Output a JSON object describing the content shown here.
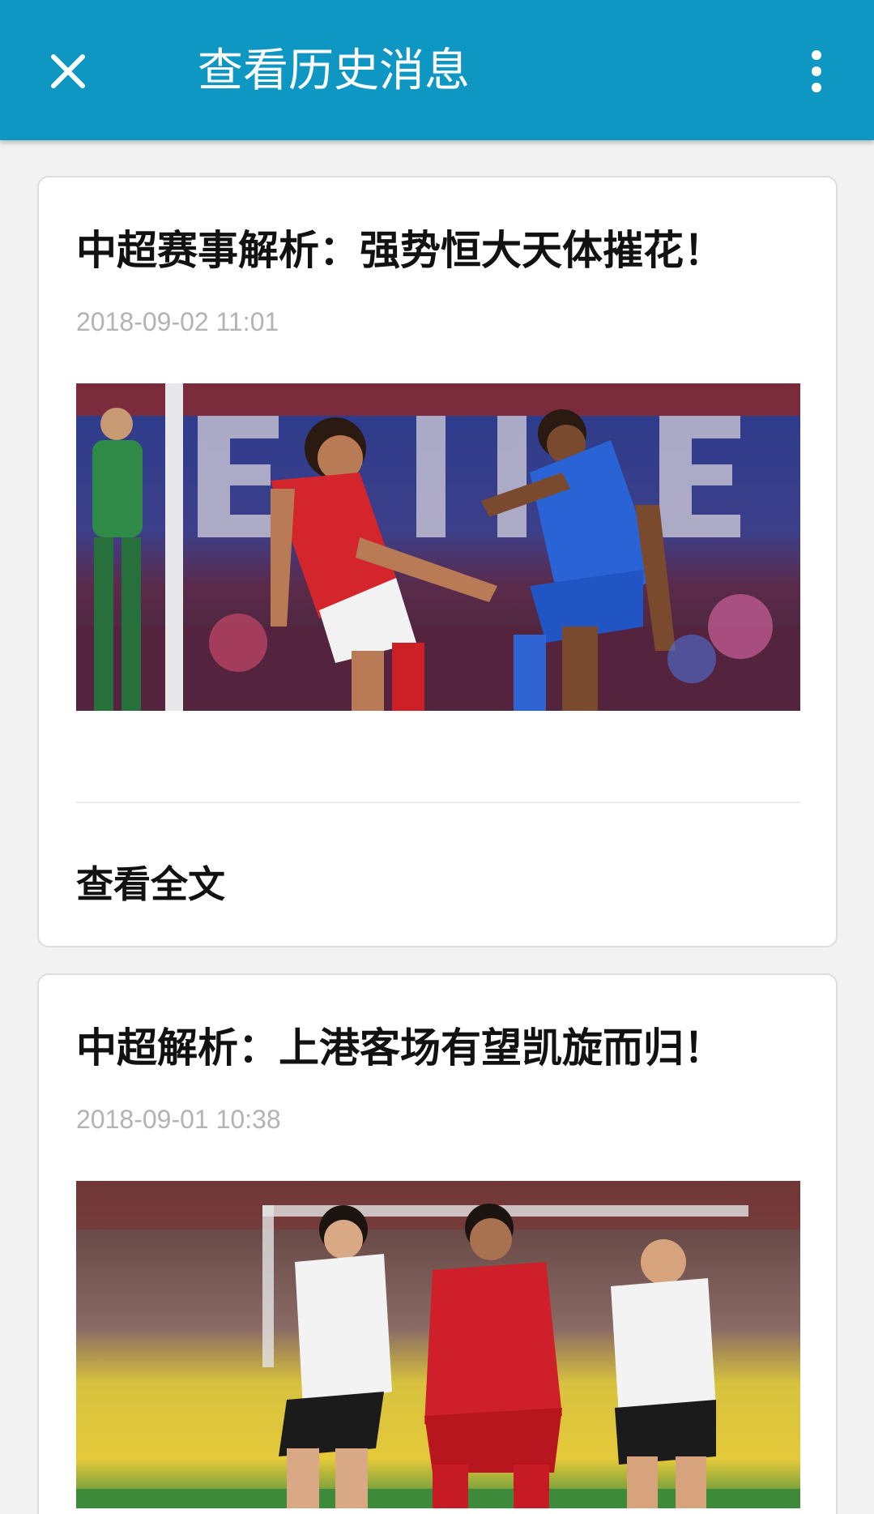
{
  "header": {
    "title": "查看历史消息",
    "close_icon": "close-icon",
    "more_icon": "more-vertical-icon",
    "background_color": "#0f97c4"
  },
  "articles": [
    {
      "title": "中超赛事解析：强势恒大天体摧花！",
      "date": "2018-09-02 11:01",
      "read_more": "查看全文"
    },
    {
      "title": "中超解析：上港客场有望凯旋而归！",
      "date": "2018-09-01 10:38"
    }
  ]
}
